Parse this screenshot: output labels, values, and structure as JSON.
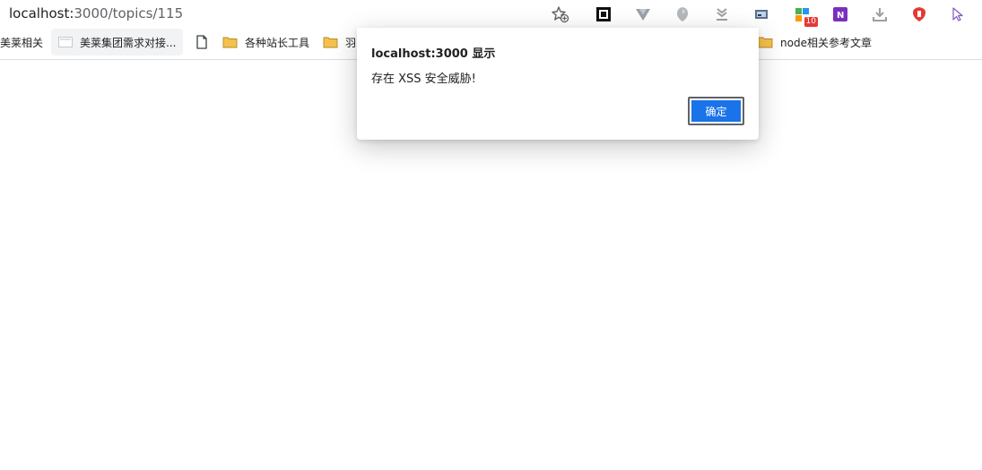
{
  "address_bar": {
    "host": "localhost:",
    "path": "3000/topics/115"
  },
  "extensions": {
    "notification_count": "10"
  },
  "bookmarks": [
    {
      "label": "美莱相关",
      "icon": "none"
    },
    {
      "label": "美莱集团需求对接...",
      "icon": "page-thumb-icon"
    },
    {
      "label": "",
      "icon": "file-icon"
    },
    {
      "label": "各种站长工具",
      "icon": "folder-icon"
    },
    {
      "label": "羽",
      "icon": "folder-icon"
    },
    {
      "label": "node相关参考文章",
      "icon": "folder-icon"
    }
  ],
  "dialog": {
    "title": "localhost:3000 显示",
    "message": "存在 XSS 安全威胁!",
    "ok_label": "确定"
  },
  "colors": {
    "accent": "#1a73e8",
    "folder": "#f4c14d",
    "badge": "#e53935"
  }
}
